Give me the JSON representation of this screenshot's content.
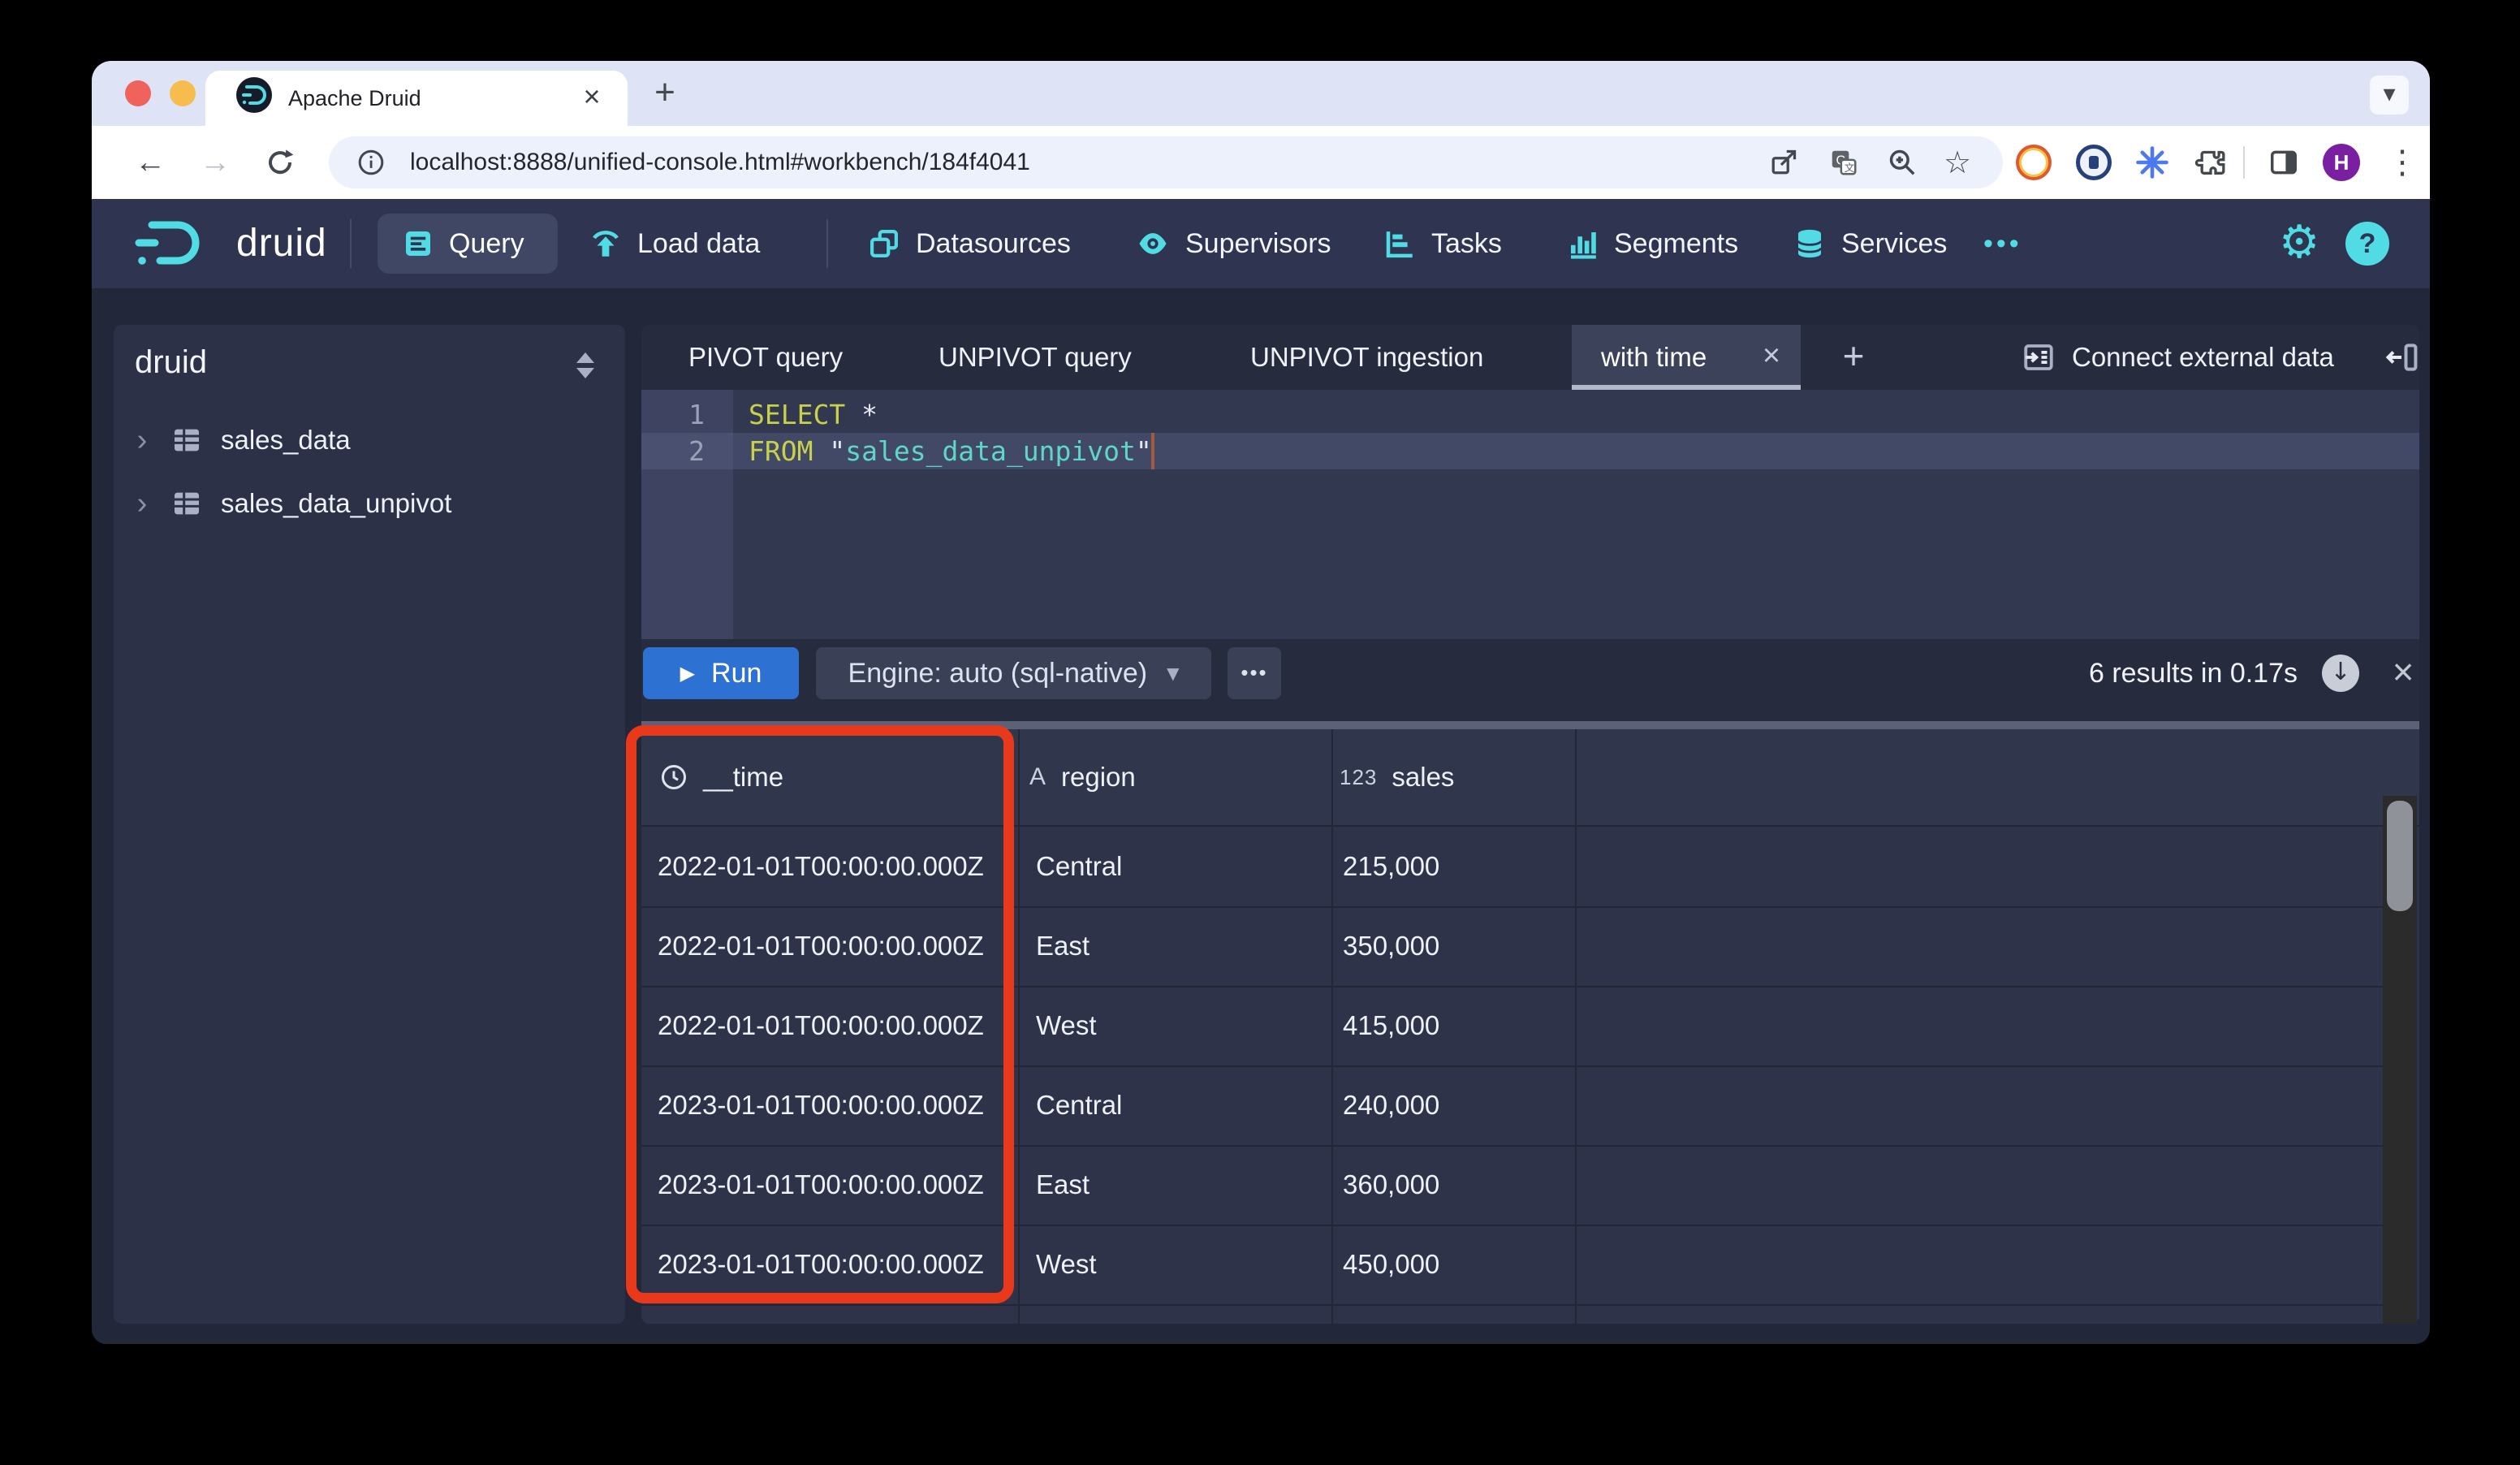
{
  "icons": {
    "close": "×",
    "plus": "+",
    "back": "←",
    "forward": "→",
    "star": "☆",
    "kebab": "⋮",
    "overflow_dots": "•••",
    "engine_dots": "•••",
    "caret_down": "▼",
    "play": "▶",
    "download_arrow": "↓",
    "tree_chevron": "›",
    "tabstrip_chevron": "▾",
    "gear": "⚙",
    "help": "?"
  },
  "browser": {
    "tab_title": "Apache Druid",
    "url": "localhost:8888/unified-console.html#workbench/184f4041",
    "profile_initial": "H"
  },
  "navbar": {
    "brand": "druid",
    "items": [
      {
        "label": "Query",
        "active": true
      },
      {
        "label": "Load data"
      },
      {
        "label": "Datasources"
      },
      {
        "label": "Supervisors"
      },
      {
        "label": "Tasks"
      },
      {
        "label": "Segments"
      },
      {
        "label": "Services"
      }
    ]
  },
  "sidebar": {
    "schema": "druid",
    "tables": [
      {
        "name": "sales_data"
      },
      {
        "name": "sales_data_unpivot"
      }
    ]
  },
  "workbench": {
    "tabs": [
      {
        "label": "PIVOT query"
      },
      {
        "label": "UNPIVOT query"
      },
      {
        "label": "UNPIVOT ingestion"
      },
      {
        "label": "with time",
        "active": true
      }
    ],
    "connect_label": "Connect external data",
    "run_label": "Run",
    "engine_label": "Engine: auto (sql-native)",
    "results_summary": "6 results in 0.17s",
    "editor": {
      "lines": [
        {
          "number": "1",
          "keyword": "SELECT",
          "rest": " *"
        },
        {
          "number": "2",
          "keyword": "FROM",
          "open_quote": " \"",
          "string": "sales_data_unpivot",
          "close_quote": "\""
        }
      ]
    }
  },
  "results": {
    "columns": [
      {
        "name": "__time",
        "badge": ""
      },
      {
        "name": "region",
        "badge": "A"
      },
      {
        "name": "sales",
        "badge": "123"
      }
    ],
    "rows": [
      [
        "2022-01-01T00:00:00.000Z",
        "Central",
        "215,000"
      ],
      [
        "2022-01-01T00:00:00.000Z",
        "East",
        "350,000"
      ],
      [
        "2022-01-01T00:00:00.000Z",
        "West",
        "415,000"
      ],
      [
        "2023-01-01T00:00:00.000Z",
        "Central",
        "240,000"
      ],
      [
        "2023-01-01T00:00:00.000Z",
        "East",
        "360,000"
      ],
      [
        "2023-01-01T00:00:00.000Z",
        "West",
        "450,000"
      ]
    ]
  },
  "colors": {
    "accent_cyan": "#51dce5",
    "run_blue": "#2d72d2",
    "highlight_red": "#e8391c"
  }
}
